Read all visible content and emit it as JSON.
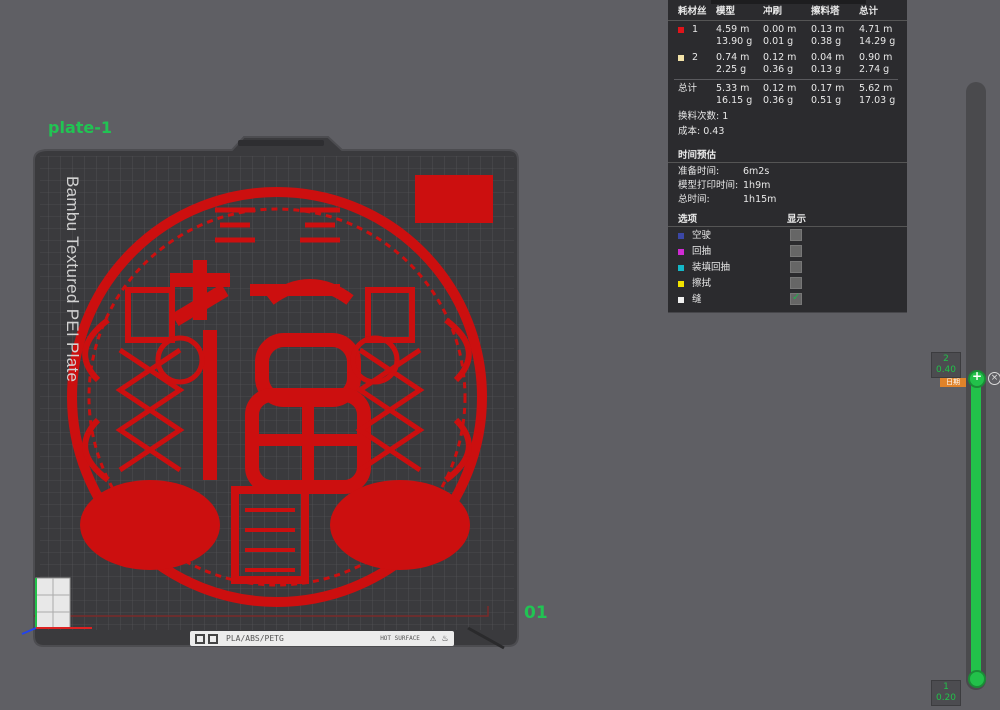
{
  "viewport": {
    "plate_label": "plate-1",
    "plate_number": "01",
    "bed_name": "Bambu Textured PEI Plate",
    "bed_material_text": "PLA/ABS/PETG",
    "bed_hot_text": "HOT SURFACE",
    "model_color": "#cc0f0f"
  },
  "stats": {
    "headers": [
      "耗材丝",
      "模型",
      "冲刷",
      "擦料塔",
      "总计"
    ],
    "filaments": [
      {
        "id": "1",
        "color": "#e0141a",
        "model": [
          "4.59 m",
          "13.90 g"
        ],
        "flush": [
          "0.00 m",
          "0.01 g"
        ],
        "tower": [
          "0.13 m",
          "0.38 g"
        ],
        "total": [
          "4.71 m",
          "14.29 g"
        ]
      },
      {
        "id": "2",
        "color": "#f2e2a8",
        "model": [
          "0.74 m",
          "2.25 g"
        ],
        "flush": [
          "0.12 m",
          "0.36 g"
        ],
        "tower": [
          "0.04 m",
          "0.13 g"
        ],
        "total": [
          "0.90 m",
          "2.74 g"
        ]
      }
    ],
    "summary": {
      "label": "总计",
      "model": [
        "5.33 m",
        "16.15 g"
      ],
      "flush": [
        "0.12 m",
        "0.36 g"
      ],
      "tower": [
        "0.17 m",
        "0.51 g"
      ],
      "total": [
        "5.62 m",
        "17.03 g"
      ]
    },
    "changes": "换料次数:  1",
    "cost": "成本:  0.43",
    "time_title": "时间预估",
    "prep_label": "准备时间:",
    "prep_value": "6m2s",
    "model_time_label": "模型打印时间:",
    "model_time_value": "1h9m",
    "total_time_label": "总时间:",
    "total_time_value": "1h15m",
    "options_title": "选项",
    "display_title": "显示",
    "options": [
      {
        "label": "空驶",
        "color": "#3b47a6",
        "checked": false
      },
      {
        "label": "回抽",
        "color": "#d02bd4",
        "checked": false
      },
      {
        "label": "装填回抽",
        "color": "#14b8c8",
        "checked": false
      },
      {
        "label": "擦拭",
        "color": "#f2e300",
        "checked": false
      },
      {
        "label": "缝",
        "color": "#f0f0f0",
        "checked": true
      }
    ]
  },
  "slider": {
    "top_layer": "2",
    "top_height": "0.40",
    "bottom_layer": "1",
    "bottom_height": "0.20",
    "cog_text": "日期"
  }
}
